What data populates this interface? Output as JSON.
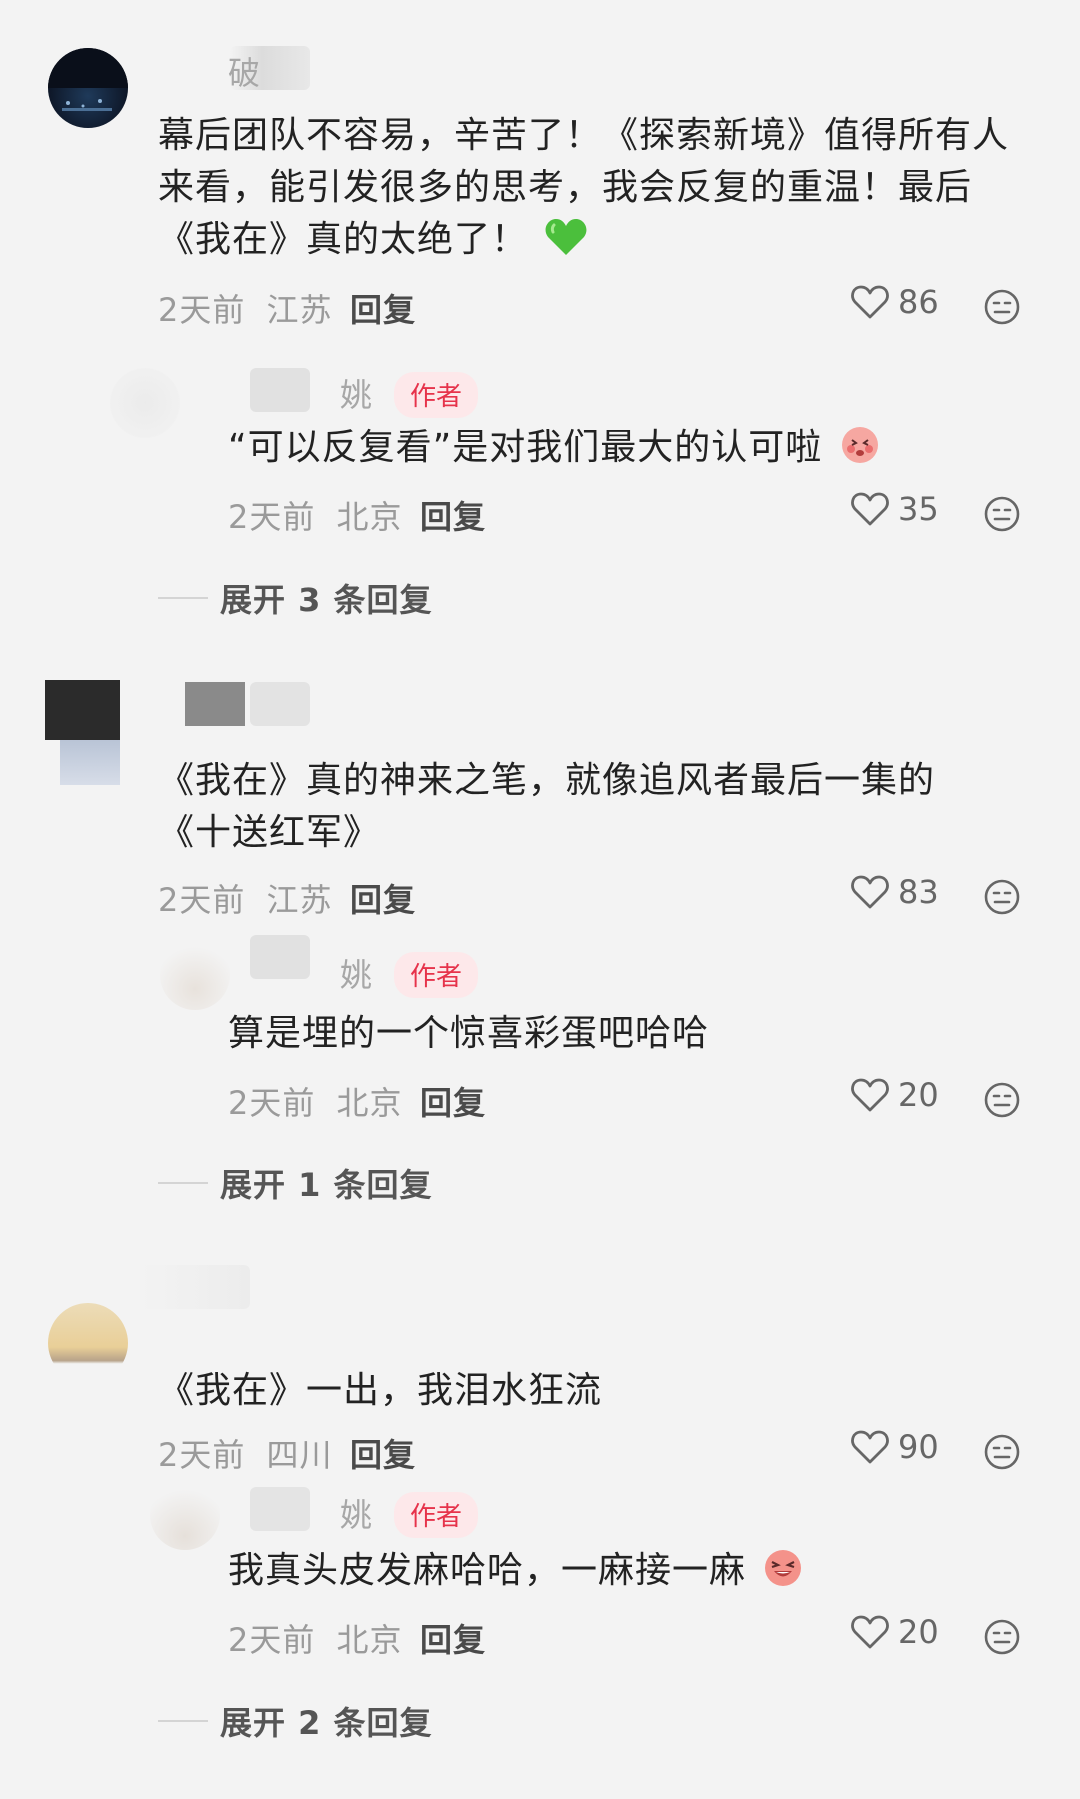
{
  "threads": [
    {
      "comment": {
        "name": "        破",
        "text": "幕后团队不容易，辛苦了！《探索新境》值得所有人来看，能引发很多的思考，我会反复的重温！最后《我在》真的太绝了！",
        "emoji": "green-heart",
        "time": "2天前",
        "location": "江苏",
        "reply_label": "回复",
        "likes": "86"
      },
      "reply": {
        "name": "姚",
        "badge": "作者",
        "text": "“可以反复看”是对我们最大的认可啦",
        "emoji": "blushing-face",
        "time": "2天前",
        "location": "北京",
        "reply_label": "回复",
        "likes": "35"
      },
      "expand_label": "展开 3 条回复"
    },
    {
      "comment": {
        "name": "",
        "text": "《我在》真的神来之笔，就像追风者最后一集的《十送红军》",
        "time": "2天前",
        "location": "江苏",
        "reply_label": "回复",
        "likes": "83"
      },
      "reply": {
        "name": "姚",
        "badge": "作者",
        "text": "算是埋的一个惊喜彩蛋吧哈哈",
        "time": "2天前",
        "location": "北京",
        "reply_label": "回复",
        "likes": "20"
      },
      "expand_label": "展开 1 条回复"
    },
    {
      "comment": {
        "name": "",
        "text": "《我在》一出，我泪水狂流",
        "time": "2天前",
        "location": "四川",
        "reply_label": "回复",
        "likes": "90"
      },
      "reply": {
        "name": "姚",
        "badge": "作者",
        "text": "我真头皮发麻哈哈，一麻接一麻",
        "emoji": "laughing-face",
        "time": "2天前",
        "location": "北京",
        "reply_label": "回复",
        "likes": "20"
      },
      "expand_label": "展开 2 条回复"
    }
  ]
}
